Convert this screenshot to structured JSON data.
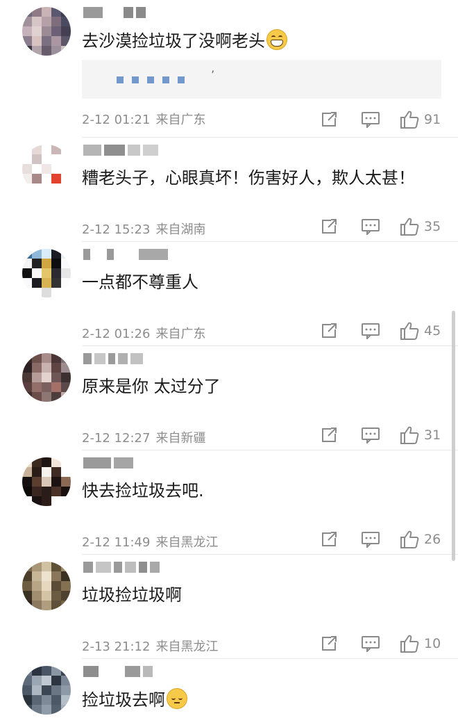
{
  "comments": [
    {
      "text": "去沙漠捡垃圾了没啊老头",
      "emoji": "grin-icon",
      "quote": "’",
      "date": "2-12 01:21",
      "location": "来自广东",
      "likes": "91"
    },
    {
      "text": "糟老头子，心眼真坏！伤害好人，欺人太甚！",
      "date": "2-12 15:23",
      "location": "来自湖南",
      "likes": "35"
    },
    {
      "text": "一点都不尊重人",
      "date": "2-12 01:26",
      "location": "来自广东",
      "likes": "45"
    },
    {
      "text": "原来是你 太过分了",
      "date": "2-12 12:27",
      "location": "来自新疆",
      "likes": "31"
    },
    {
      "text": "快去捡垃圾去吧.",
      "date": "2-12 11:49",
      "location": "来自黑龙江",
      "likes": "26"
    },
    {
      "text": "垃圾捡垃圾啊",
      "date": "2-13 21:12",
      "location": "来自黑龙江",
      "likes": "10"
    },
    {
      "text": "捡垃圾去啊",
      "emoji": "eye-roll-icon"
    }
  ],
  "colors": {
    "text": "#1b1b1b",
    "meta": "#8d8d8d",
    "divider": "#e7e7e7",
    "quote_bg": "#f4f4f4"
  },
  "icons": {
    "share": "share-icon",
    "reply": "comment-icon",
    "like": "thumbs-up-icon"
  }
}
